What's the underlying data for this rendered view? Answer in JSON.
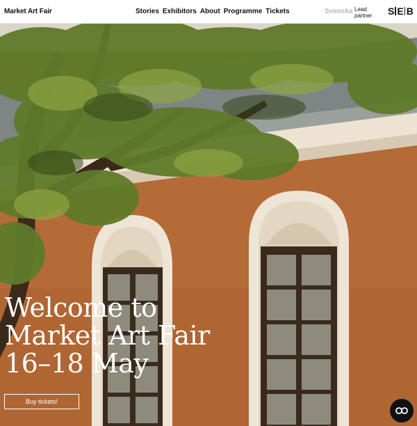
{
  "header": {
    "logo": "Market Art Fair",
    "nav": [
      "Stories",
      "Exhibitors",
      "About",
      "Programme",
      "Tickets"
    ],
    "language": "Svenska",
    "partner_label": "Lead partner",
    "partner_logo": "SEB"
  },
  "hero": {
    "headline": [
      "Welcome to",
      "Market Art Fair",
      "16–18 May"
    ],
    "cta_label": "Buy tickets!",
    "image_description_colors": {
      "wall": "#b26a36",
      "trim": "#efe5d6",
      "foliage": "#5f7a2a"
    }
  },
  "chat": {
    "icon": "chat-bubble-icon"
  }
}
